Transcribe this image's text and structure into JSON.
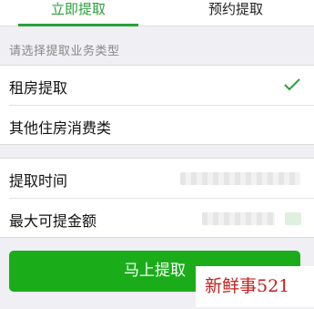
{
  "tabs": [
    {
      "label": "立即提取",
      "active": true
    },
    {
      "label": "预约提取",
      "active": false
    }
  ],
  "section_hint": "请选择提取业务类型",
  "withdraw_types": [
    {
      "label": "租房提取",
      "selected": true
    },
    {
      "label": "其他住房消费类",
      "selected": false
    }
  ],
  "info": {
    "time_label": "提取时间",
    "max_amount_label": "最大可提金额"
  },
  "submit_label": "马上提取",
  "watermark": "新鲜事521",
  "colors": {
    "accent": "#29a03a",
    "button": "#1aad19",
    "watermark": "#c41f1f"
  },
  "icons": {
    "selected": "checkmark-icon"
  }
}
